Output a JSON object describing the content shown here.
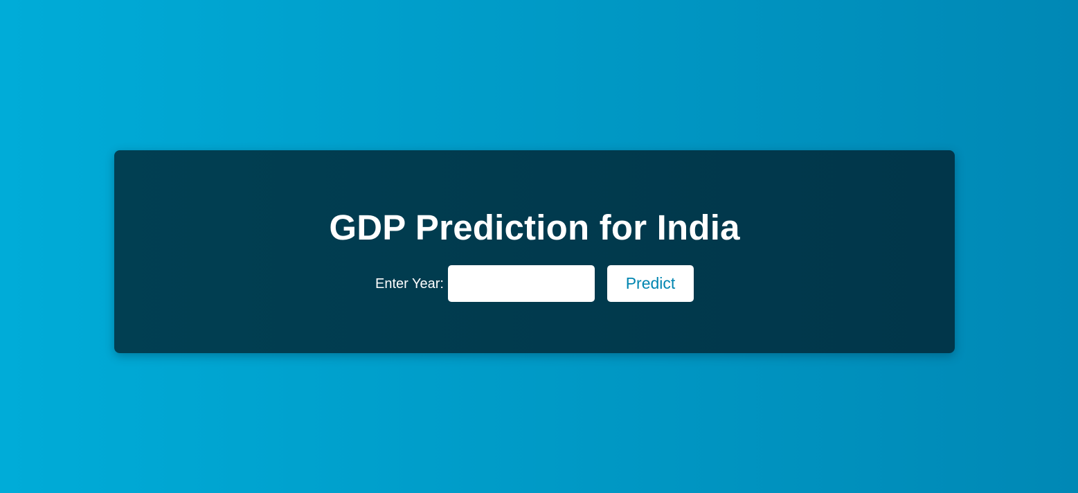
{
  "colors": {
    "background_start": "#00acd8",
    "background_end": "#0088b5",
    "card": "#013f52",
    "accent": "#0085b0",
    "text": "#ffffff"
  },
  "card": {
    "title": "GDP Prediction for India",
    "form": {
      "year_label": "Enter Year:",
      "year_value": "",
      "year_placeholder": "",
      "predict_label": "Predict"
    }
  }
}
